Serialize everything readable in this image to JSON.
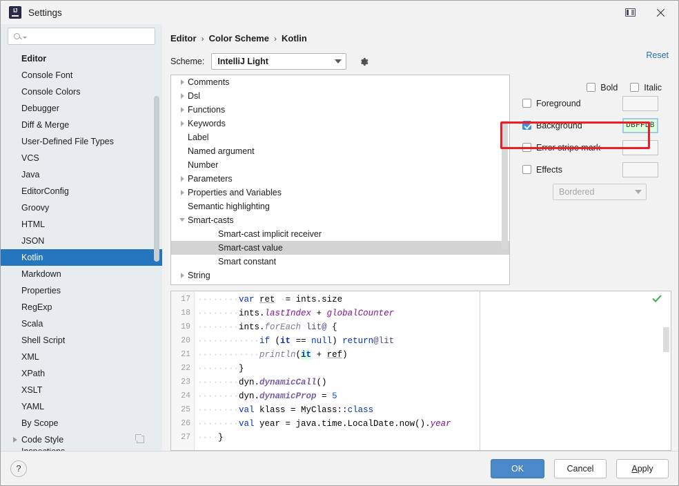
{
  "window": {
    "title": "Settings",
    "app_icon": "intellij-logo-icon",
    "panel_toggle_icon": "toggle-sidebar-icon",
    "close_icon": "close-icon"
  },
  "sidebar": {
    "search": {
      "placeholder": "",
      "value": "",
      "icon": "search-icon"
    },
    "items": [
      {
        "label": "Editor",
        "level": 0,
        "group": true,
        "expandable": false
      },
      {
        "label": "Console Font",
        "level": 1
      },
      {
        "label": "Console Colors",
        "level": 1
      },
      {
        "label": "Debugger",
        "level": 1
      },
      {
        "label": "Diff & Merge",
        "level": 1
      },
      {
        "label": "User-Defined File Types",
        "level": 1
      },
      {
        "label": "VCS",
        "level": 1
      },
      {
        "label": "Java",
        "level": 1
      },
      {
        "label": "EditorConfig",
        "level": 1
      },
      {
        "label": "Groovy",
        "level": 1
      },
      {
        "label": "HTML",
        "level": 1
      },
      {
        "label": "JSON",
        "level": 1
      },
      {
        "label": "Kotlin",
        "level": 1,
        "selected": true
      },
      {
        "label": "Markdown",
        "level": 1
      },
      {
        "label": "Properties",
        "level": 1
      },
      {
        "label": "RegExp",
        "level": 1
      },
      {
        "label": "Scala",
        "level": 1
      },
      {
        "label": "Shell Script",
        "level": 1
      },
      {
        "label": "XML",
        "level": 1
      },
      {
        "label": "XPath",
        "level": 1
      },
      {
        "label": "XSLT",
        "level": 1
      },
      {
        "label": "YAML",
        "level": 1
      },
      {
        "label": "By Scope",
        "level": 1
      },
      {
        "label": "Code Style",
        "level": 0,
        "expandable": true,
        "has_copy_icon": true
      }
    ]
  },
  "header": {
    "breadcrumb": [
      "Editor",
      "Color Scheme",
      "Kotlin"
    ],
    "breadcrumb_separator": "›",
    "reset_label": "Reset"
  },
  "scheme": {
    "label": "Scheme:",
    "selected": "IntelliJ Light",
    "gear_icon": "gear-settings-icon"
  },
  "categories": [
    {
      "label": "Comments",
      "expandable": "collapsed",
      "child": false
    },
    {
      "label": "Dsl",
      "expandable": "collapsed",
      "child": false
    },
    {
      "label": "Functions",
      "expandable": "collapsed",
      "child": false
    },
    {
      "label": "Keywords",
      "expandable": "collapsed",
      "child": false
    },
    {
      "label": "Label",
      "expandable": "none",
      "child": false
    },
    {
      "label": "Named argument",
      "expandable": "none",
      "child": false
    },
    {
      "label": "Number",
      "expandable": "none",
      "child": false
    },
    {
      "label": "Parameters",
      "expandable": "collapsed",
      "child": false
    },
    {
      "label": "Properties and Variables",
      "expandable": "collapsed",
      "child": false
    },
    {
      "label": "Semantic highlighting",
      "expandable": "none",
      "child": false
    },
    {
      "label": "Smart-casts",
      "expandable": "expanded",
      "child": false
    },
    {
      "label": "Smart-cast implicit receiver",
      "expandable": "none",
      "child": true
    },
    {
      "label": "Smart-cast value",
      "expandable": "none",
      "child": true,
      "selected": true
    },
    {
      "label": "Smart constant",
      "expandable": "none",
      "child": true
    },
    {
      "label": "String",
      "expandable": "collapsed",
      "child": false
    }
  ],
  "options": {
    "bold": {
      "label": "Bold",
      "checked": false
    },
    "italic": {
      "label": "Italic",
      "checked": false
    },
    "foreground": {
      "label": "Foreground",
      "checked": false,
      "color": ""
    },
    "background": {
      "label": "Background",
      "checked": true,
      "color": "DBFFDB",
      "highlighted": true
    },
    "error_stripe_mark": {
      "label": "Error stripe mark",
      "checked": false,
      "color": ""
    },
    "effects": {
      "label": "Effects",
      "checked": false,
      "color": ""
    },
    "effect_type": {
      "value": "Bordered",
      "enabled": false
    }
  },
  "preview": {
    "first_line_number": 17,
    "line_numbers": [
      17,
      18,
      19,
      20,
      21,
      22,
      23,
      24,
      25,
      26,
      27
    ],
    "lines": [
      "        var ret = ints.size",
      "        ints.lastIndex + globalCounter",
      "        ints.forEach lit@ {",
      "            if (it == null) return@lit",
      "            println(it + ref)",
      "        }",
      "        dyn.dynamicCall()",
      "        dyn.dynamicProp = 5",
      "        val klass = MyClass::class",
      "        val year = java.time.LocalDate.now().year",
      "    }"
    ],
    "status_icon": "inspection-ok-check-icon"
  },
  "footer": {
    "help_label": "?",
    "ok_label": "OK",
    "cancel_label": "Cancel",
    "apply_label": "Apply",
    "apply_mnemonic": "A"
  },
  "colors": {
    "accent": "#2675bf",
    "primary_button": "#4a88c7",
    "link": "#2470b3",
    "highlight_box": "#ee1c25",
    "background_swatch": "#DBFFDB",
    "sidebar_bg": "#e7ecef"
  }
}
